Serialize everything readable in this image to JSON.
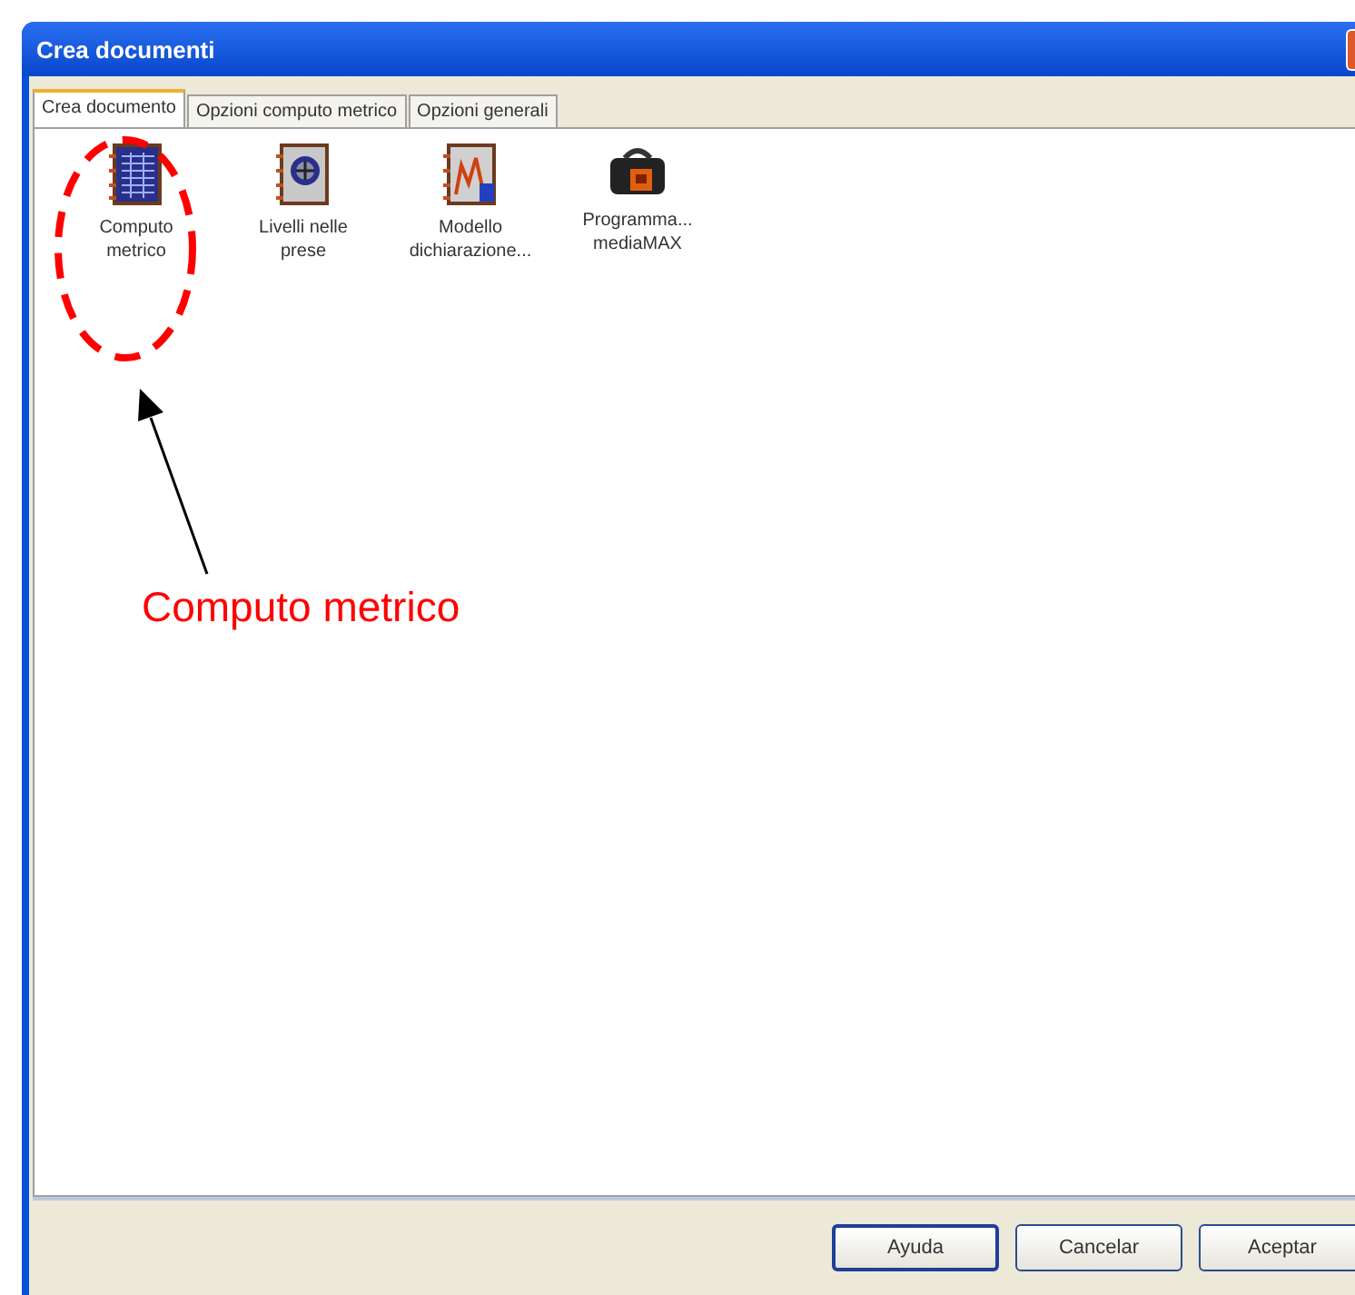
{
  "window": {
    "title": "Crea documenti"
  },
  "tabs": [
    {
      "label": "Crea documento",
      "selected": true
    },
    {
      "label": "Opzioni computo metrico",
      "selected": false
    },
    {
      "label": "Opzioni generali",
      "selected": false
    }
  ],
  "items": [
    {
      "kind": "grid",
      "label": "Computo metrico"
    },
    {
      "kind": "disc",
      "label": "Livelli nelle prese"
    },
    {
      "kind": "chart",
      "label": "Modello dichiarazione..."
    },
    {
      "kind": "bag",
      "label": "Programma... mediaMAX"
    }
  ],
  "annotation": {
    "label": "Computo metrico"
  },
  "buttons": [
    "Ayuda",
    "Cancelar",
    "Aceptar"
  ]
}
